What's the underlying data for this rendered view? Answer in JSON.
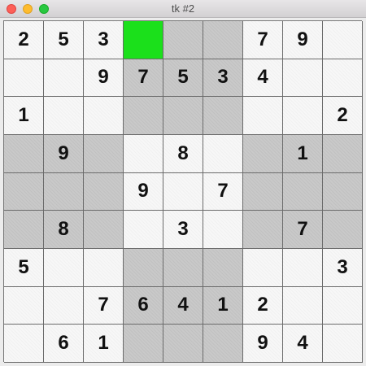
{
  "window": {
    "title": "tk #2"
  },
  "colors": {
    "selected": "#1be01b",
    "light_cell": "#f7f7f7",
    "dark_cell": "#c9c9c9"
  },
  "selected": {
    "row": 0,
    "col": 3
  },
  "grid": [
    [
      "2",
      "5",
      "3",
      "",
      "",
      "",
      "7",
      "9",
      ""
    ],
    [
      "",
      "",
      "9",
      "7",
      "5",
      "3",
      "4",
      "",
      ""
    ],
    [
      "1",
      "",
      "",
      "",
      "",
      "",
      "",
      "",
      "2"
    ],
    [
      "",
      "9",
      "",
      "",
      "8",
      "",
      "",
      "1",
      ""
    ],
    [
      "",
      "",
      "",
      "9",
      "",
      "7",
      "",
      "",
      ""
    ],
    [
      "",
      "8",
      "",
      "",
      "3",
      "",
      "",
      "7",
      ""
    ],
    [
      "5",
      "",
      "",
      "",
      "",
      "",
      "",
      "",
      "3"
    ],
    [
      "",
      "",
      "7",
      "6",
      "4",
      "1",
      "2",
      "",
      ""
    ],
    [
      "",
      "6",
      "1",
      "",
      "",
      "",
      "9",
      "4",
      ""
    ]
  ]
}
